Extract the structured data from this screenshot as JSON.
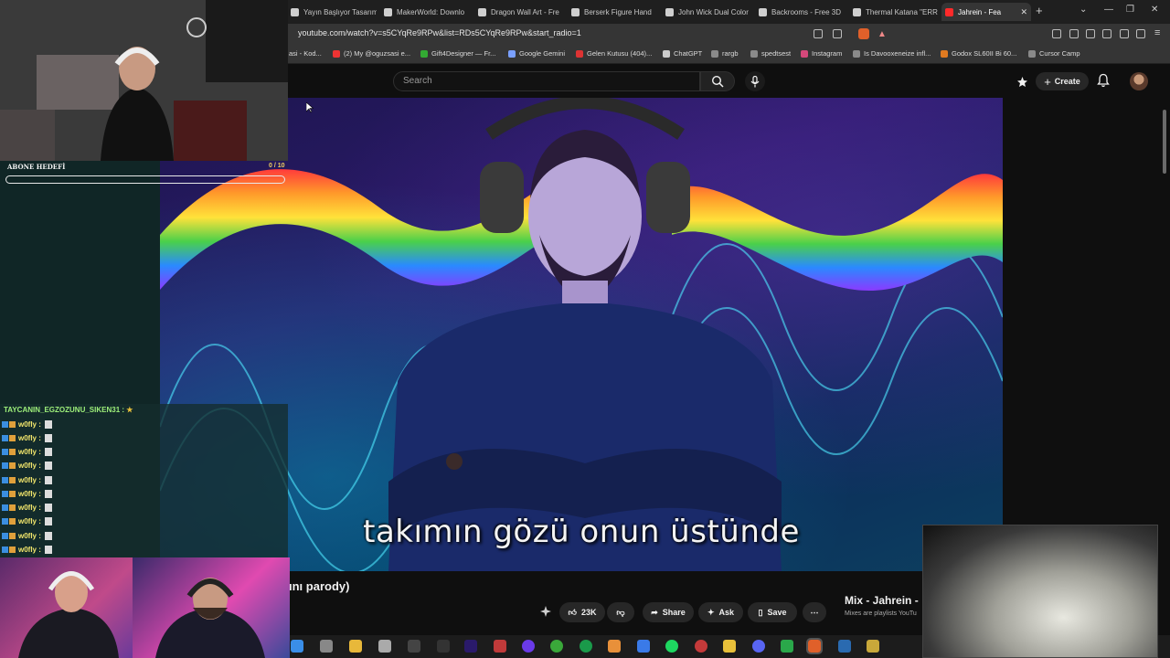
{
  "browser": {
    "tabs": [
      {
        "label": "Yayın Başlıyor Tasarım"
      },
      {
        "label": "MakerWorld: Downlo"
      },
      {
        "label": "Dragon Wall Art - Fre"
      },
      {
        "label": "Berserk Figure Hand"
      },
      {
        "label": "John Wick Dual Color"
      },
      {
        "label": "Backrooms - Free 3D"
      },
      {
        "label": "Thermal Katana \"ERR"
      },
      {
        "label": "Jahrein - Fea",
        "active": true
      }
    ],
    "url": "youtube.com/watch?v=s5CYqRe9RPw&list=RDs5CYqRe9RPw&start_radio=1",
    "bookmarks": [
      "asi - Kod...",
      "(2) My @oguzsasi e...",
      "Gift4Designer — Fr...",
      "Google Gemini",
      "Gelen Kutusu (404)...",
      "ChatGPT",
      "rargb",
      "spedtsest",
      "Instagram",
      "Is Davooxeneize infl...",
      "Godox SL60II Bi 60...",
      "Cursor Camp"
    ]
  },
  "youtube": {
    "search_placeholder": "Search",
    "create_label": "Create",
    "subtitle": "takımın gözü onun üstünde",
    "video_title_fragment": "ını parody)",
    "like_count": "23K",
    "share_label": "Share",
    "ask_label": "Ask",
    "save_label": "Save",
    "mix_title": "Mix - Jahrein -",
    "mix_subtitle": "Mixes are playlists YouTu"
  },
  "stream_overlay": {
    "goal_label": "ABONE HEDEFİ",
    "goal_count": "0 / 10",
    "goal_progress": 0,
    "chat_header": "TAYCANIN_EGZOZUNU_SIKEN31 :",
    "chat_lines": [
      {
        "user": "w0fly :"
      },
      {
        "user": "w0fly :"
      },
      {
        "user": "w0fly :"
      },
      {
        "user": "w0fly :"
      },
      {
        "user": "w0fly :"
      },
      {
        "user": "w0fly :"
      },
      {
        "user": "w0fly :"
      },
      {
        "user": "w0fly :"
      },
      {
        "user": "w0fly :"
      },
      {
        "user": "w0fly :"
      }
    ]
  }
}
